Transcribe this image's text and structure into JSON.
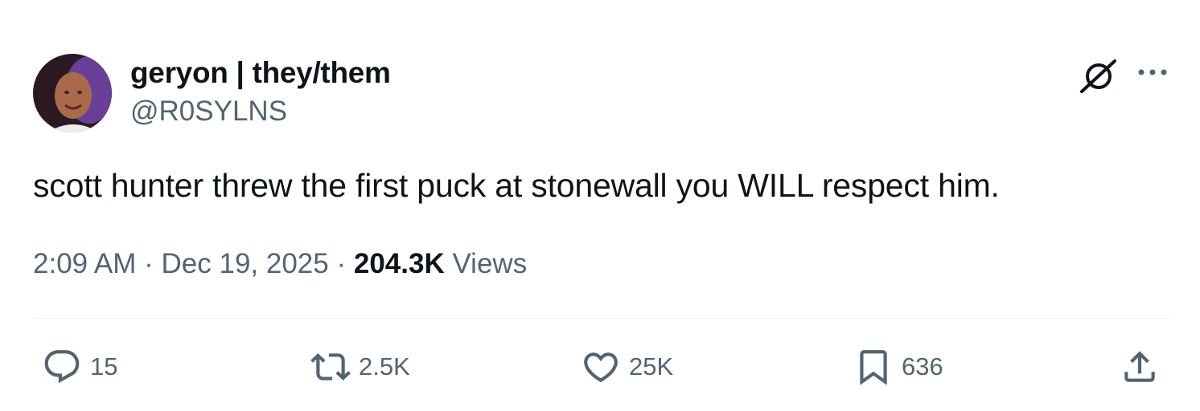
{
  "author": {
    "display_name": "geryon | they/them",
    "handle": "@R0SYLNS",
    "avatar_icon": "profile-photo"
  },
  "header_icons": {
    "grok": "grok-icon",
    "more": "more-icon"
  },
  "tweet": {
    "text": "scott hunter threw the first puck at stonewall you WILL respect him."
  },
  "meta": {
    "time": "2:09 AM",
    "separator": " · ",
    "date": "Dec 19, 2025",
    "views_count": "204.3K",
    "views_label": " Views"
  },
  "actions": {
    "replies": "15",
    "reposts": "2.5K",
    "likes": "25K",
    "bookmarks": "636"
  },
  "colors": {
    "text_primary": "#0f1419",
    "text_secondary": "#536471",
    "divider": "#eff3f4"
  }
}
